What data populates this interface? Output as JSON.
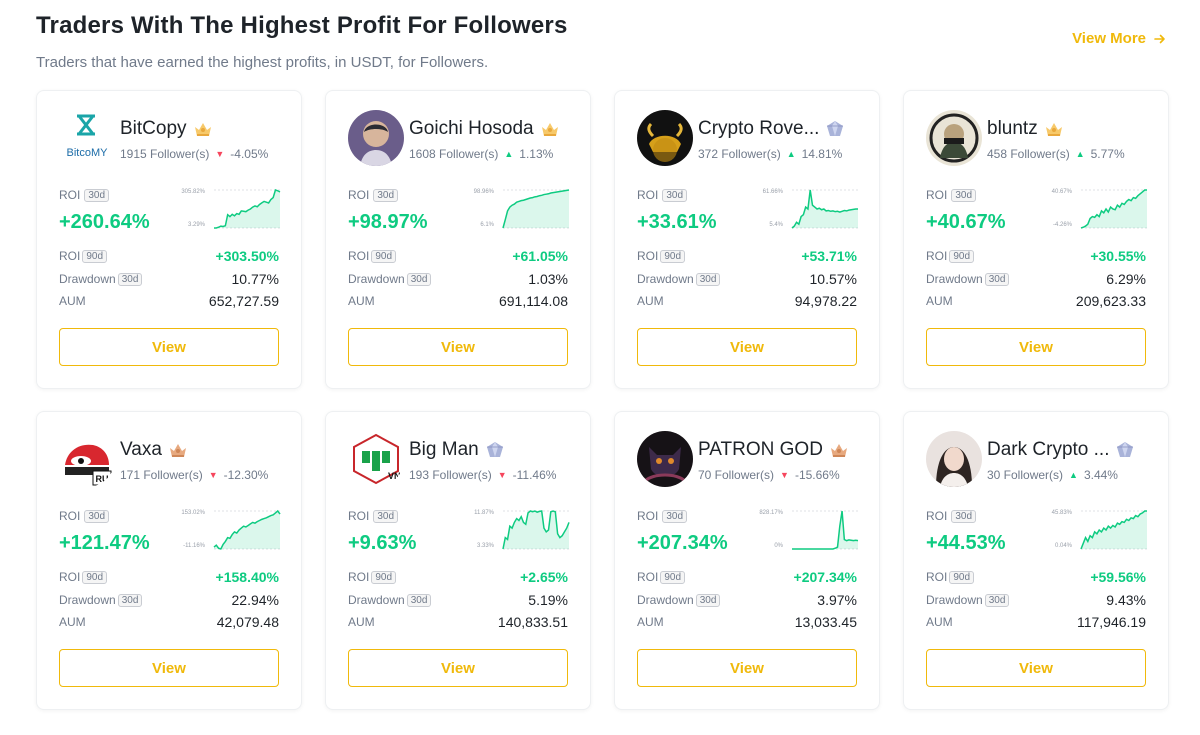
{
  "header": {
    "title": "Traders With The Highest Profit For Followers",
    "subtitle": "Traders that have earned the highest profits, in USDT, for Followers.",
    "view_more": "View More"
  },
  "labels": {
    "roi": "ROI",
    "drawdown": "Drawdown",
    "aum": "AUM",
    "period_30d": "30d",
    "period_90d": "90d",
    "view": "View"
  },
  "colors": {
    "accent": "#f0b90b",
    "positive": "#0ecb81",
    "negative": "#f6465d"
  },
  "traders": [
    {
      "name": "BitCopy",
      "badge": "gold-badge-icon",
      "followers": "1915 Follower(s)",
      "change": "-4.05%",
      "direction": "down",
      "roi_30d": "+260.64%",
      "chart_max_label": "305.82%",
      "chart_min_label": "3.29%",
      "chart_series": [
        0.0,
        0.0,
        0.02,
        0.05,
        0.04,
        0.06,
        0.35,
        0.3,
        0.36,
        0.32,
        0.38,
        0.36,
        0.45,
        0.44,
        0.43,
        0.47,
        0.5,
        0.55,
        0.58,
        0.56,
        0.62,
        0.66,
        0.7,
        0.68,
        0.66,
        0.75,
        0.8,
        1.0,
        0.98,
        0.95
      ],
      "roi_90d": "+303.50%",
      "drawdown_30d": "10.77%",
      "aum": "652,727.59",
      "avatar_text": "BitcoMY",
      "avatar_icon": "bitcopy-logo-icon"
    },
    {
      "name": "Goichi Hosoda",
      "badge": "gold-badge-icon",
      "followers": "1608 Follower(s)",
      "change": "1.13%",
      "direction": "up",
      "roi_30d": "+98.97%",
      "chart_max_label": "98.96%",
      "chart_min_label": "6.1%",
      "chart_series": [
        0.0,
        0.22,
        0.45,
        0.55,
        0.6,
        0.63,
        0.68,
        0.7,
        0.72,
        0.73,
        0.75,
        0.77,
        0.79,
        0.8,
        0.82,
        0.83,
        0.85,
        0.86,
        0.88,
        0.89,
        0.9,
        0.92,
        0.93,
        0.94,
        0.95,
        0.96,
        0.97,
        0.98,
        0.99,
        1.0
      ],
      "roi_90d": "+61.05%",
      "drawdown_30d": "1.03%",
      "aum": "691,114.08",
      "avatar_text": "",
      "avatar_icon": "portrait-avatar-icon"
    },
    {
      "name": "Crypto Rove...",
      "badge": "diamond-badge-icon",
      "followers": "372 Follower(s)",
      "change": "14.81%",
      "direction": "up",
      "roi_30d": "+33.61%",
      "chart_max_label": "61.66%",
      "chart_min_label": "5.4%",
      "chart_series": [
        0.0,
        0.05,
        0.15,
        0.1,
        0.3,
        0.35,
        0.55,
        0.5,
        1.0,
        0.6,
        0.55,
        0.5,
        0.52,
        0.48,
        0.5,
        0.45,
        0.46,
        0.44,
        0.45,
        0.43,
        0.44,
        0.42,
        0.44,
        0.46,
        0.45,
        0.47,
        0.48,
        0.49,
        0.5,
        0.5
      ],
      "roi_90d": "+53.71%",
      "drawdown_30d": "10.57%",
      "aum": "94,978.22",
      "avatar_text": "",
      "avatar_icon": "golden-bull-avatar-icon"
    },
    {
      "name": "bluntz",
      "badge": "gold-badge-icon",
      "followers": "458 Follower(s)",
      "change": "5.77%",
      "direction": "up",
      "roi_30d": "+40.67%",
      "chart_max_label": "40.67%",
      "chart_min_label": "-4.26%",
      "chart_series": [
        0.0,
        0.02,
        0.05,
        0.1,
        0.25,
        0.3,
        0.28,
        0.35,
        0.3,
        0.45,
        0.4,
        0.5,
        0.42,
        0.55,
        0.5,
        0.48,
        0.6,
        0.55,
        0.65,
        0.62,
        0.7,
        0.75,
        0.72,
        0.8,
        0.78,
        0.85,
        0.9,
        0.95,
        1.0,
        1.0
      ],
      "roi_90d": "+30.55%",
      "drawdown_30d": "6.29%",
      "aum": "209,623.33",
      "avatar_text": "",
      "avatar_icon": "masked-figure-avatar-icon"
    },
    {
      "name": "Vaxa",
      "badge": "bronze-badge-icon",
      "followers": "171 Follower(s)",
      "change": "-12.30%",
      "direction": "down",
      "roi_30d": "+121.47%",
      "chart_max_label": "153.02%",
      "chart_min_label": "-11.16%",
      "chart_series": [
        0.05,
        0.1,
        0.02,
        0.0,
        0.12,
        0.2,
        0.3,
        0.28,
        0.38,
        0.45,
        0.42,
        0.5,
        0.55,
        0.6,
        0.58,
        0.62,
        0.66,
        0.7,
        0.68,
        0.72,
        0.75,
        0.78,
        0.8,
        0.82,
        0.85,
        0.88,
        0.9,
        0.95,
        1.0,
        0.92
      ],
      "roi_90d": "+158.40%",
      "drawdown_30d": "22.94%",
      "aum": "42,079.48",
      "avatar_text": "RU",
      "avatar_icon": "red-car-avatar-icon"
    },
    {
      "name": "Big Man",
      "badge": "diamond-badge-icon",
      "followers": "193 Follower(s)",
      "change": "-11.46%",
      "direction": "down",
      "roi_30d": "+9.63%",
      "chart_max_label": "11.87%",
      "chart_min_label": "3.33%",
      "chart_series": [
        0.0,
        0.3,
        0.25,
        0.6,
        0.55,
        0.7,
        0.8,
        0.75,
        0.85,
        0.7,
        0.65,
        0.95,
        1.0,
        0.98,
        1.0,
        0.97,
        0.99,
        1.0,
        0.55,
        0.45,
        0.5,
        0.98,
        1.0,
        0.98,
        0.4,
        0.3,
        0.35,
        0.45,
        0.55,
        0.7
      ],
      "roi_90d": "+2.65%",
      "drawdown_30d": "5.19%",
      "aum": "140,833.51",
      "avatar_text": "VN",
      "avatar_icon": "green-shield-logo-icon"
    },
    {
      "name": "PATRON GOD",
      "badge": "bronze-badge-icon",
      "followers": "70 Follower(s)",
      "change": "-15.66%",
      "direction": "down",
      "roi_30d": "+207.34%",
      "chart_max_label": "828.17%",
      "chart_min_label": "0%",
      "chart_series": [
        0.0,
        0.0,
        0.0,
        0.0,
        0.0,
        0.0,
        0.0,
        0.0,
        0.0,
        0.0,
        0.0,
        0.0,
        0.0,
        0.0,
        0.0,
        0.0,
        0.0,
        0.0,
        0.0,
        0.02,
        0.05,
        0.6,
        1.0,
        0.25,
        0.22,
        0.24,
        0.23,
        0.22,
        0.23,
        0.22
      ],
      "roi_90d": "+207.34%",
      "drawdown_30d": "3.97%",
      "aum": "13,033.45",
      "avatar_text": "",
      "avatar_icon": "dark-cat-avatar-icon"
    },
    {
      "name": "Dark Crypto ...",
      "badge": "diamond-badge-icon",
      "followers": "30 Follower(s)",
      "change": "3.44%",
      "direction": "up",
      "roi_30d": "+44.53%",
      "chart_max_label": "45.83%",
      "chart_min_label": "0.04%",
      "chart_series": [
        0.0,
        0.15,
        0.3,
        0.2,
        0.35,
        0.3,
        0.45,
        0.4,
        0.5,
        0.45,
        0.55,
        0.5,
        0.6,
        0.55,
        0.62,
        0.58,
        0.68,
        0.65,
        0.72,
        0.7,
        0.78,
        0.75,
        0.82,
        0.8,
        0.88,
        0.85,
        0.92,
        0.95,
        1.0,
        1.0
      ],
      "roi_90d": "+59.56%",
      "drawdown_30d": "9.43%",
      "aum": "117,946.19",
      "avatar_text": "",
      "avatar_icon": "woman-portrait-avatar-icon"
    }
  ]
}
